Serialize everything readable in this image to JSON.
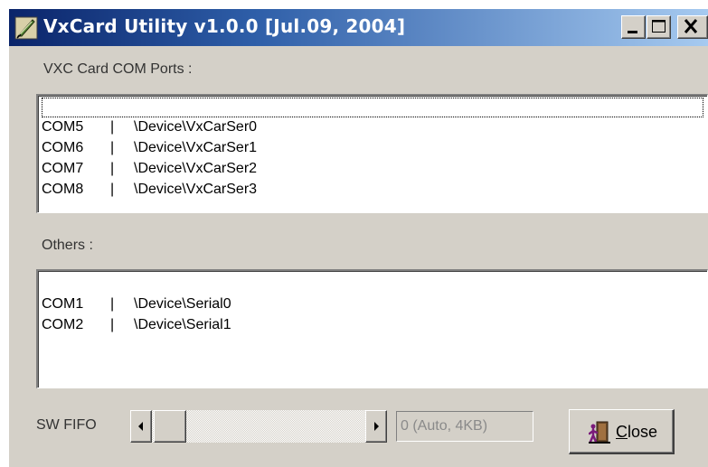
{
  "window": {
    "title": "VxCard Utility v1.0.0 [Jul.09, 2004]",
    "icon": "feather-pen-icon",
    "controls": [
      "minimize-icon",
      "maximize-icon",
      "close-icon"
    ]
  },
  "vxc_section": {
    "label": "VXC Card COM Ports :",
    "items": [
      {
        "port": "COM5",
        "sep": "|",
        "device": "\\Device\\VxCarSer0",
        "focused": true
      },
      {
        "port": "COM6",
        "sep": "|",
        "device": "\\Device\\VxCarSer1"
      },
      {
        "port": "COM7",
        "sep": "|",
        "device": "\\Device\\VxCarSer2"
      },
      {
        "port": "COM8",
        "sep": "|",
        "device": "\\Device\\VxCarSer3"
      }
    ]
  },
  "others_section": {
    "label": "Others :",
    "items": [
      {
        "port": "COM1",
        "sep": "|",
        "device": "\\Device\\Serial0"
      },
      {
        "port": "COM2",
        "sep": "|",
        "device": "\\Device\\Serial1"
      }
    ]
  },
  "sw_fifo": {
    "label": "SW FIFO",
    "value_text": "0 (Auto, 4KB)",
    "slider_position": 0
  },
  "close_button": {
    "label_underlined": "C",
    "label_rest": "lose",
    "icon": "exit-door-icon"
  }
}
